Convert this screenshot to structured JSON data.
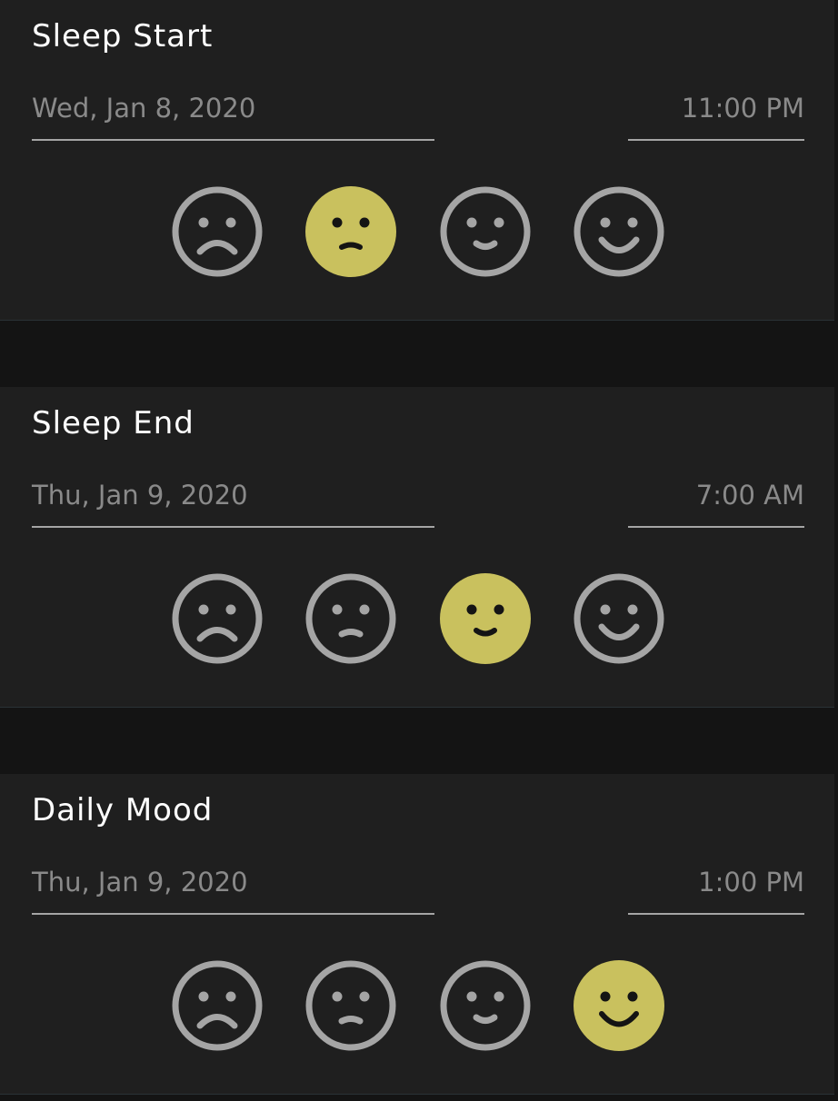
{
  "cards": [
    {
      "title": "Sleep Start",
      "date": "Wed, Jan 8, 2020",
      "time": "11:00 PM",
      "selected_mood": 2,
      "selected_mood_name": "neutral"
    },
    {
      "title": "Sleep End",
      "date": "Thu, Jan 9, 2020",
      "time": "7:00 AM",
      "selected_mood": 3,
      "selected_mood_name": "content"
    },
    {
      "title": "Daily Mood",
      "date": "Thu, Jan 9, 2020",
      "time": "1:00 PM",
      "selected_mood": 4,
      "selected_mood_name": "happy"
    }
  ],
  "mood_scale": [
    {
      "level": 1,
      "icon": "sad-face-icon"
    },
    {
      "level": 2,
      "icon": "neutral-face-icon"
    },
    {
      "level": 3,
      "icon": "slight-smile-face-icon"
    },
    {
      "level": 4,
      "icon": "happy-face-icon"
    }
  ],
  "colors": {
    "background": "#141414",
    "card": "#1f1f1f",
    "selected": "#c9c15e",
    "unselected": "#a5a5a5",
    "title": "#ffffff",
    "field_text": "#8a8a8a"
  }
}
